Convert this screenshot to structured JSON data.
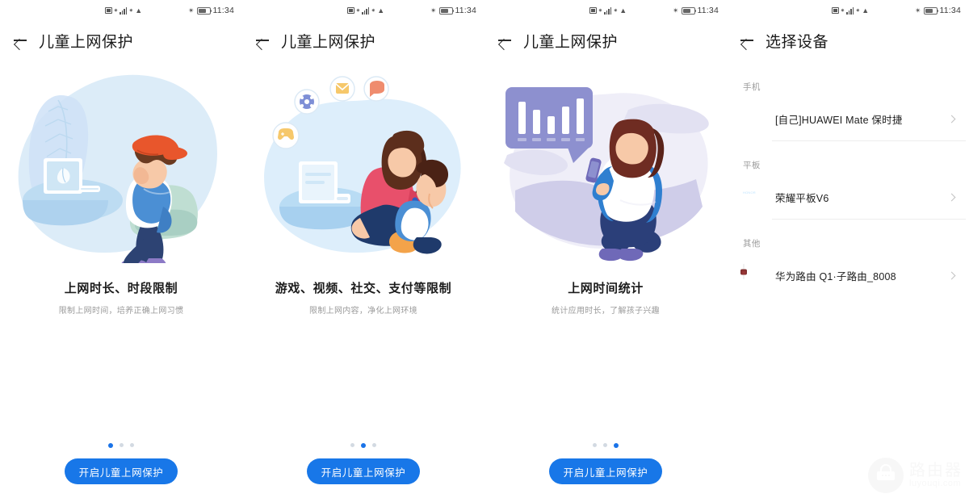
{
  "statusbar": {
    "time": "11:34",
    "icons": [
      "sim-card-icon",
      "signal-bars-icon",
      "wifi-icon",
      "bluetooth-icon",
      "battery-icon"
    ]
  },
  "colors": {
    "accent": "#1877e8",
    "dot_active": "#1a73e8",
    "dot_inactive": "#d3dae2",
    "title_text": "#1c1c1c",
    "sub_text": "#9a9a9a",
    "phone_icon": "#d7302a",
    "tablet_icon": "#2196f3"
  },
  "panels": [
    {
      "id": "panel-intro-1",
      "back_icon": "back-arrow-icon",
      "title": "儿童上网保护",
      "illustration": "boy-on-sofa-with-computer-illustration",
      "caption_title": "上网时长、时段限制",
      "caption_sub": "限制上网时间，培养正确上网习惯",
      "dots": 3,
      "active_dot": 1,
      "cta_label": "开启儿童上网保护"
    },
    {
      "id": "panel-intro-2",
      "back_icon": "back-arrow-icon",
      "title": "儿童上网保护",
      "illustration": "mother-and-child-with-app-icons-illustration",
      "caption_title": "游戏、视频、社交、支付等限制",
      "caption_sub": "限制上网内容，净化上网环境",
      "dots": 3,
      "active_dot": 2,
      "cta_label": "开启儿童上网保护"
    },
    {
      "id": "panel-intro-3",
      "back_icon": "back-arrow-icon",
      "title": "儿童上网保护",
      "illustration": "boy-with-phone-and-bar-chart-illustration",
      "caption_title": "上网时间统计",
      "caption_sub": "统计应用时长，了解孩子兴趣",
      "dots": 3,
      "active_dot": 3,
      "cta_label": "开启儿童上网保护"
    }
  ],
  "device_panel": {
    "id": "panel-select-device",
    "back_icon": "back-arrow-icon",
    "title": "选择设备",
    "sections": [
      {
        "label": "手机",
        "items": [
          {
            "name": "[自己]HUAWEI Mate 保时捷",
            "icon": "phone-icon",
            "chevron": "chevron-right-icon"
          }
        ]
      },
      {
        "label": "平板",
        "items": [
          {
            "name": "荣耀平板V6",
            "icon": "tablet-icon",
            "chevron": "chevron-right-icon"
          }
        ]
      },
      {
        "label": "其他",
        "items": [
          {
            "name": "华为路由 Q1·子路由_8008",
            "icon": "router-icon",
            "chevron": "chevron-right-icon"
          }
        ]
      }
    ]
  },
  "watermark": {
    "cn": "路由器",
    "en": "luyouqi.com",
    "icon": "router-watermark-icon"
  }
}
